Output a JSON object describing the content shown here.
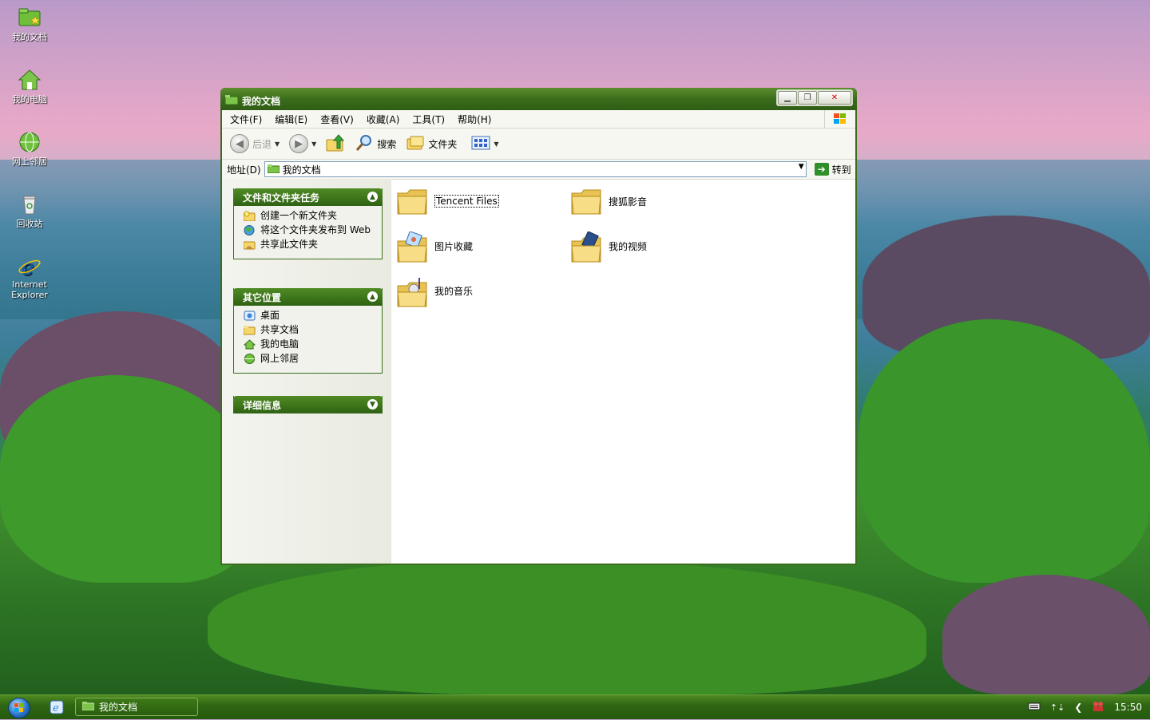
{
  "desktop": {
    "icons": [
      {
        "label": "我的文档"
      },
      {
        "label": "我的电脑"
      },
      {
        "label": "网上邻居"
      },
      {
        "label": "回收站"
      },
      {
        "label": "Internet Explorer"
      }
    ]
  },
  "window": {
    "title": "我的文档",
    "menu": [
      "文件(F)",
      "编辑(E)",
      "查看(V)",
      "收藏(A)",
      "工具(T)",
      "帮助(H)"
    ],
    "toolbar": {
      "back": "后退",
      "search": "搜索",
      "folders": "文件夹"
    },
    "address": {
      "label": "地址(D)",
      "value": "我的文档",
      "go": "转到"
    },
    "panels": {
      "tasks": {
        "title": "文件和文件夹任务",
        "items": [
          "创建一个新文件夹",
          "将这个文件夹发布到 Web",
          "共享此文件夹"
        ]
      },
      "places": {
        "title": "其它位置",
        "items": [
          "桌面",
          "共享文档",
          "我的电脑",
          "网上邻居"
        ]
      },
      "details": {
        "title": "详细信息"
      }
    },
    "files": [
      {
        "name": "Tencent Files"
      },
      {
        "name": "搜狐影音"
      },
      {
        "name": "图片收藏"
      },
      {
        "name": "我的视频"
      },
      {
        "name": "我的音乐"
      }
    ]
  },
  "taskbar": {
    "task_label": "我的文档",
    "clock": "15:50"
  },
  "colors": {
    "theme_green": "#3b6d1c",
    "folder_yellow": "#f5d66b"
  }
}
